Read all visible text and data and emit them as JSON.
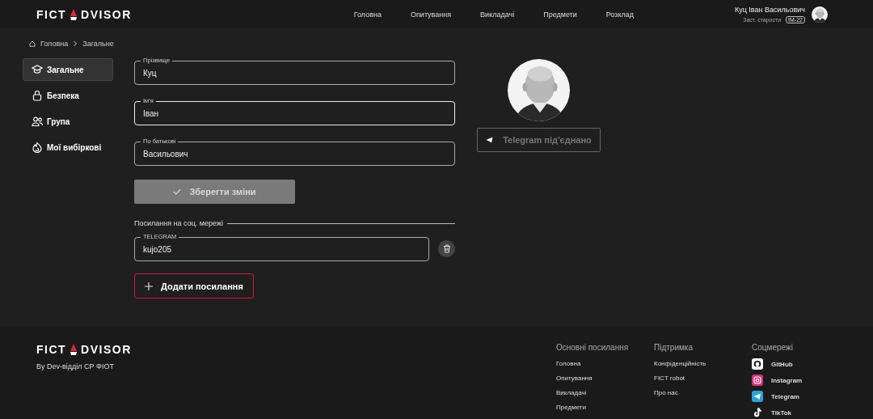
{
  "header": {
    "logo": {
      "left": "FICT",
      "right": "DVISOR"
    },
    "nav": [
      "Головна",
      "Опитування",
      "Викладачі",
      "Предмети",
      "Розклад"
    ],
    "user": {
      "name": "Куц Іван Васильович",
      "role": "Заст. старости",
      "group": "ІМ-22"
    }
  },
  "breadcrumbs": [
    "Головна",
    "Загальне"
  ],
  "sidebar": {
    "items": [
      {
        "label": "Загальне",
        "selected": true
      },
      {
        "label": "Безпека",
        "selected": false
      },
      {
        "label": "Група",
        "selected": false
      },
      {
        "label": "Мої вибіркові",
        "selected": false
      }
    ]
  },
  "form": {
    "fields": [
      {
        "label": "Прізвище",
        "value": "Куц",
        "focused": false
      },
      {
        "label": "Ім'я",
        "value": "Іван",
        "focused": true
      },
      {
        "label": "По батькові",
        "value": "Васильович",
        "focused": false
      }
    ],
    "save_button": {
      "label": "Зберегти зміни",
      "disabled": true
    },
    "social_heading": "Посилання на соц. мережі",
    "social_links": [
      {
        "label": "TELEGRAM",
        "value": "kujo205"
      }
    ],
    "add_button": "Додати посилання"
  },
  "profile": {
    "telegram_button": {
      "label": "Telegram під'єднано",
      "disabled": true
    }
  },
  "footer": {
    "logo": {
      "left": "FICT",
      "right": "DVISOR"
    },
    "credit": "By Dev-відділ СР ФІОТ",
    "columns": [
      {
        "title": "Основні посилання",
        "links": [
          "Головна",
          "Опитування",
          "Викладачі",
          "Предмети"
        ]
      },
      {
        "title": "Підтримка",
        "links": [
          "Конфіденційність",
          "FICT robot",
          "Про нас"
        ]
      }
    ],
    "social": {
      "title": "Соцмережі",
      "links": [
        "GitHub",
        "Instagram",
        "Telegram",
        "TikTok"
      ]
    }
  }
}
